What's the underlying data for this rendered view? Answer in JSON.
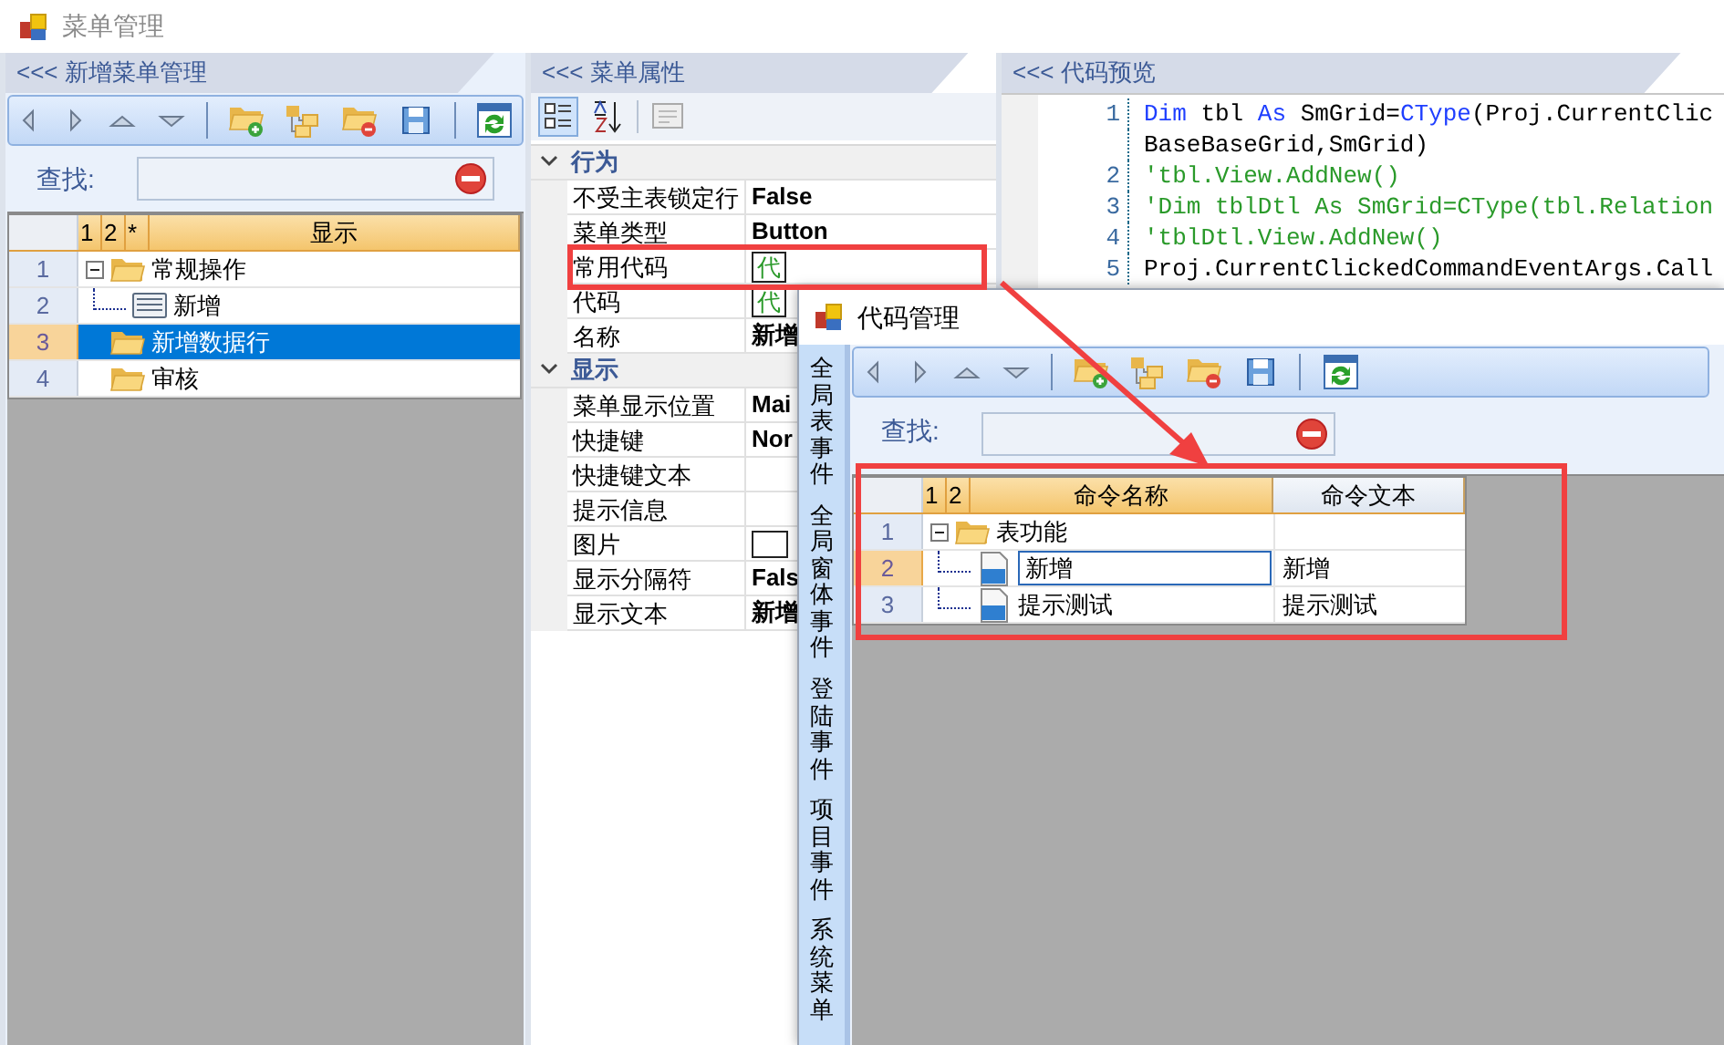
{
  "window": {
    "title": "菜单管理"
  },
  "menu_panel": {
    "title": "<<< 新增菜单管理",
    "search": {
      "label": "查找:"
    },
    "grid": {
      "level_columns": [
        "1",
        "2",
        "*"
      ],
      "columns": [
        "显示"
      ],
      "rows": [
        {
          "row": "1",
          "label": "常规操作",
          "kind": "folder",
          "selected": false,
          "expanded": true,
          "children": [
            {
              "row": "2",
              "label": "新增",
              "kind": "button",
              "selected": false
            }
          ]
        },
        {
          "row": "3",
          "label": "新增数据行",
          "kind": "folder",
          "selected": true
        },
        {
          "row": "4",
          "label": "审核",
          "kind": "folder",
          "selected": false
        }
      ]
    }
  },
  "property_panel": {
    "title": "<<< 菜单属性",
    "categories": [
      {
        "title": "行为",
        "expanded": true,
        "properties": [
          {
            "name": "不受主表锁定行",
            "kind": "text",
            "value": "False"
          },
          {
            "name": "菜单类型",
            "kind": "text",
            "value": "Button"
          },
          {
            "name": "常用代码",
            "kind": "code-box",
            "value": "代"
          },
          {
            "name": "代码",
            "kind": "code-box",
            "value": "代"
          },
          {
            "name": "名称",
            "kind": "text",
            "value": "新增"
          }
        ]
      },
      {
        "title": "显示",
        "expanded": true,
        "properties": [
          {
            "name": "菜单显示位置",
            "kind": "text",
            "value": "Mai"
          },
          {
            "name": "快捷键",
            "kind": "text",
            "value": "Nor"
          },
          {
            "name": "快捷键文本",
            "kind": "text"
          },
          {
            "name": "提示信息",
            "kind": "text"
          },
          {
            "name": "图片",
            "kind": "image-box"
          },
          {
            "name": "显示分隔符",
            "kind": "text",
            "value": "Fals"
          },
          {
            "name": "显示文本",
            "kind": "text",
            "value": "新增"
          }
        ]
      }
    ]
  },
  "code_preview": {
    "title": "<<< 代码预览",
    "lines": [
      {
        "number": "1",
        "tokens": [
          {
            "kind": "keyword",
            "text": "Dim"
          },
          {
            "kind": "plain",
            "text": " tbl "
          },
          {
            "kind": "keyword",
            "text": "As"
          },
          {
            "kind": "plain",
            "text": " SmGrid="
          },
          {
            "kind": "keyword",
            "text": "CType"
          },
          {
            "kind": "plain",
            "text": "(Proj.CurrentClic"
          }
        ]
      },
      {
        "tokens": [
          {
            "kind": "plain",
            "text": "BaseBaseGrid,SmGrid)"
          }
        ]
      },
      {
        "number": "2",
        "tokens": [
          {
            "kind": "comment",
            "text": "'tbl.View.AddNew()"
          }
        ]
      },
      {
        "number": "3",
        "tokens": [
          {
            "kind": "comment",
            "text": "'Dim tblDtl As SmGrid=CType(tbl.Relation"
          }
        ]
      },
      {
        "number": "4",
        "tokens": [
          {
            "kind": "comment",
            "text": "'tblDtl.View.AddNew()"
          }
        ]
      },
      {
        "number": "5",
        "tokens": [
          {
            "kind": "plain",
            "text": "Proj.CurrentClickedCommandEventArgs.Call"
          }
        ]
      }
    ]
  },
  "code_dialog": {
    "title": "代码管理",
    "side_tabs": [
      {
        "label": "全局表事件"
      },
      {
        "label": "全局窗体事件"
      },
      {
        "label": "登陆事件"
      },
      {
        "label": "项目事件"
      },
      {
        "label": "系统菜单"
      }
    ],
    "search": {
      "label": "查找:"
    },
    "grid": {
      "level_columns": [
        "1",
        "2"
      ],
      "columns": [
        "命令名称",
        "命令文本"
      ],
      "rows": [
        {
          "row": "1",
          "label": "表功能",
          "kind": "folder",
          "selected": false,
          "expanded": true,
          "children": [
            {
              "row": "2",
              "label": "新增",
              "text": "新增",
              "kind": "vb",
              "selected": true,
              "editing": true
            },
            {
              "row": "3",
              "label": "提示测试",
              "text": "提示测试",
              "kind": "vb",
              "selected": false,
              "editing": false
            }
          ]
        }
      ]
    }
  }
}
